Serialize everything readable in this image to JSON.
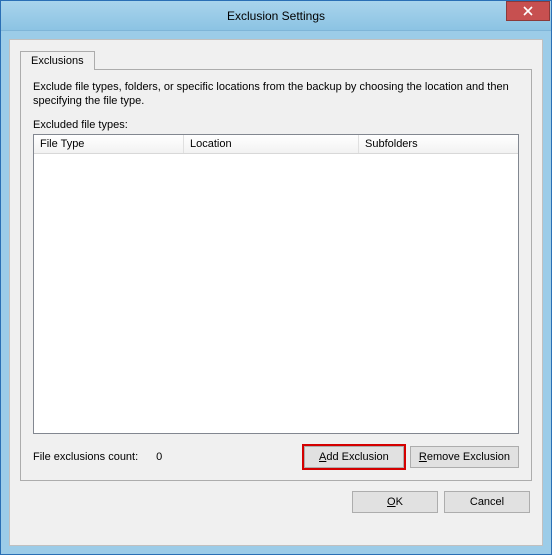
{
  "window": {
    "title": "Exclusion Settings"
  },
  "tabs": {
    "exclusions_label": "Exclusions"
  },
  "panel": {
    "description": "Exclude file types, folders, or specific locations from the backup by choosing the location and then specifying the file type.",
    "list_label": "Excluded file types:",
    "columns": {
      "file_type": "File Type",
      "location": "Location",
      "subfolders": "Subfolders"
    },
    "rows": []
  },
  "footer": {
    "count_label": "File exclusions count:",
    "count_value": "0",
    "add_btn_prefix": "A",
    "add_btn_rest": "dd Exclusion",
    "remove_btn_prefix": "R",
    "remove_btn_rest": "emove Exclusion"
  },
  "dialog": {
    "ok_prefix": "O",
    "ok_rest": "K",
    "cancel": "Cancel"
  }
}
